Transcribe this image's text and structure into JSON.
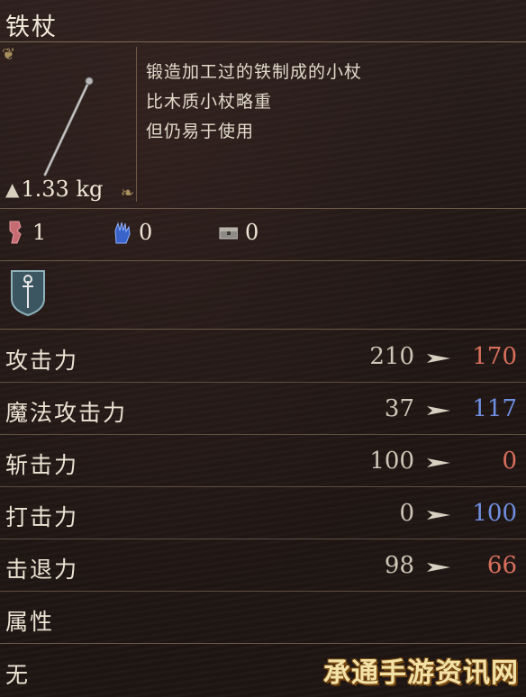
{
  "item": {
    "name": "铁杖",
    "weight": "1.33 kg",
    "description": [
      "锻造加工过的铁制成的小杖",
      "比木质小杖略重",
      "但仍易于使用"
    ]
  },
  "requirements": [
    {
      "icon": "strength-icon",
      "value": "1"
    },
    {
      "icon": "intelligence-hand-icon",
      "value": "0"
    },
    {
      "icon": "chest-icon",
      "value": "0"
    }
  ],
  "category_icon": "staff-shield-icon",
  "stats": [
    {
      "label": "攻击力",
      "current": "210",
      "new": "170",
      "trend": "down"
    },
    {
      "label": "魔法攻击力",
      "current": "37",
      "new": "117",
      "trend": "up"
    },
    {
      "label": "斩击力",
      "current": "100",
      "new": "0",
      "trend": "down"
    },
    {
      "label": "打击力",
      "current": "0",
      "new": "100",
      "trend": "up"
    },
    {
      "label": "击退力",
      "current": "98",
      "new": "66",
      "trend": "down"
    }
  ],
  "attribute": {
    "label": "属性",
    "value": "无"
  },
  "watermark": "承通手游资讯网",
  "colors": {
    "down": "#d9705c",
    "up": "#6f8fe0",
    "arrow": "#d8d0c0"
  }
}
